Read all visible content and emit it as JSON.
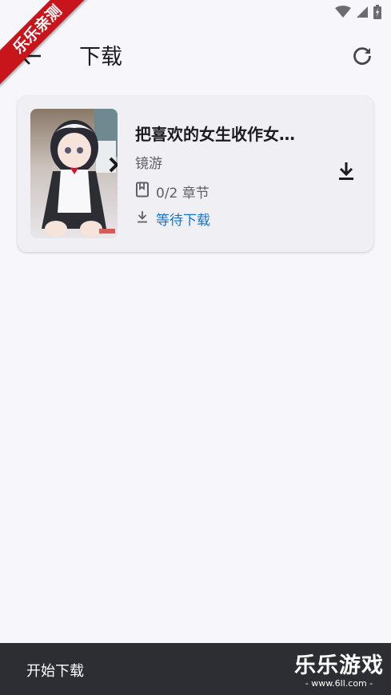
{
  "watermark": {
    "ribbon_text": "乐乐亲测"
  },
  "app_bar": {
    "title": "下载"
  },
  "download_item": {
    "title": "把喜欢的女生收作女…",
    "source": "镜游",
    "chapters": "0/2 章节",
    "status": "等待下载"
  },
  "bottom_bar": {
    "action_label": "开始下载",
    "brand_name": "乐乐游戏",
    "brand_url": "- www.6ll.com -"
  },
  "colors": {
    "background": "#f6f6fb",
    "card": "#efeff4",
    "status_accent": "#1a73c7",
    "bottom_bar": "#2c2e33",
    "ribbon": "#c8141b"
  },
  "icons": [
    "wifi-icon",
    "signal-icon",
    "battery-icon",
    "back-arrow-icon",
    "refresh-icon",
    "book-icon",
    "download-small-icon",
    "download-icon"
  ]
}
